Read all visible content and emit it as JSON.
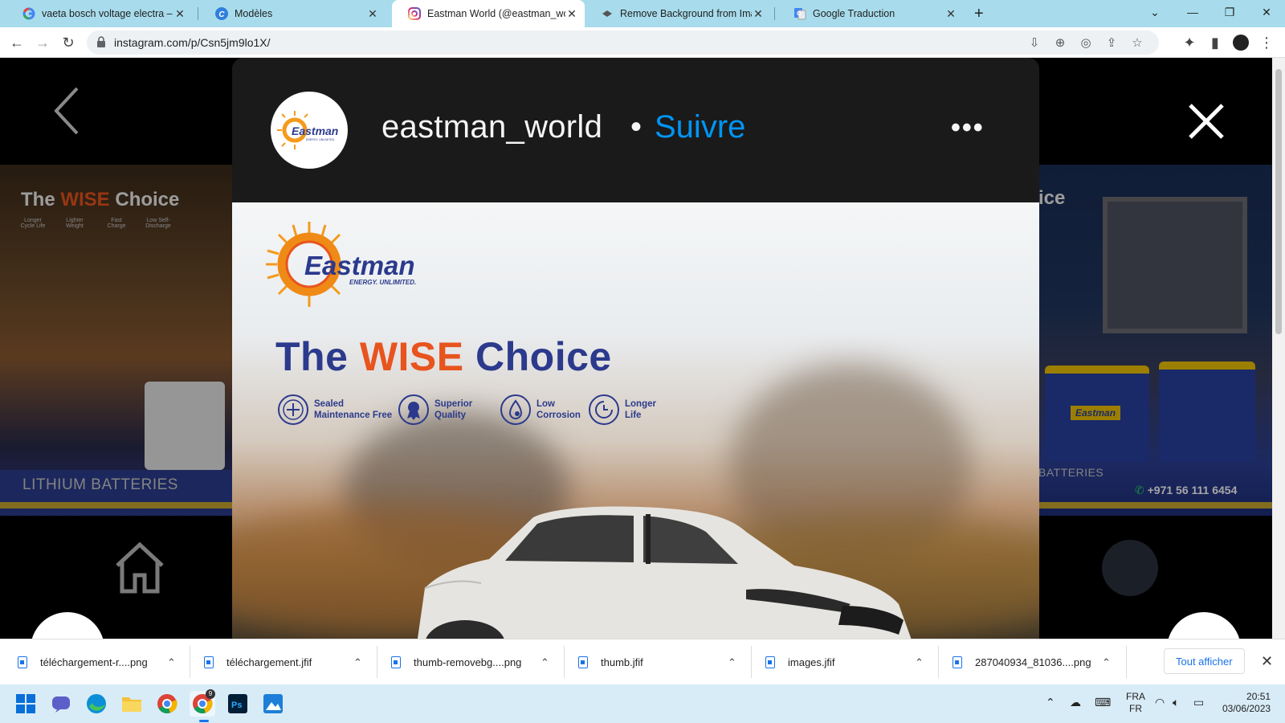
{
  "browser": {
    "tabs": [
      {
        "title": "vaeta bosch voltage electra – Rec",
        "favicon": "google-icon",
        "active": false
      },
      {
        "title": "Modèles",
        "favicon": "canva-icon",
        "active": false
      },
      {
        "title": "Eastman World (@eastman_world",
        "favicon": "instagram-icon",
        "active": true
      },
      {
        "title": "Remove Background from Image",
        "favicon": "removebg-icon",
        "active": false
      },
      {
        "title": "Google Traduction",
        "favicon": "google-translate-icon",
        "active": false
      }
    ],
    "new_tab": "+",
    "url": "instagram.com/p/Csn5jm9lo1X/"
  },
  "post": {
    "username": "eastman_world",
    "separator": "•",
    "follow_label": "Suivre",
    "more_label": "•••",
    "avatar_brand": "Eastman",
    "avatar_tagline": "ENERGY. UNLIMITED.",
    "image": {
      "brand": "Eastman",
      "tagline": "ENERGY. UNLIMITED.",
      "headline_1": "The",
      "headline_2": "WISE",
      "headline_3": "Choice",
      "features": [
        {
          "line1": "Sealed",
          "line2": "Maintenance Free"
        },
        {
          "line1": "Superior",
          "line2": "Quality"
        },
        {
          "line1": "Low",
          "line2": "Corrosion"
        },
        {
          "line1": "Longer",
          "line2": "Life"
        }
      ]
    }
  },
  "background_left": {
    "headline_1": "The",
    "headline_2": "WISE",
    "headline_3": "Choice",
    "features": [
      "Longer Cycle Life",
      "Lighter Weight",
      "Fast Charge",
      "Low Self-Discharge"
    ],
    "banner": "LITHIUM BATTERIES"
  },
  "background_right": {
    "headline": "ice",
    "banner": "BATTERIES",
    "phone": "+971 56 111 6454",
    "battery_brand": "Eastman"
  },
  "downloads": {
    "items": [
      "téléchargement-r....png",
      "téléchargement.jfif",
      "thumb-removebg....png",
      "thumb.jfif",
      "images.jfif",
      "287040934_81036....png"
    ],
    "show_all": "Tout afficher"
  },
  "taskbar": {
    "lang_top": "FRA",
    "lang_bottom": "FR",
    "time": "20:51",
    "date": "03/06/2023",
    "badge": "9"
  },
  "colors": {
    "follow_blue": "#0095f6",
    "brand_navy": "#2b3a8c",
    "brand_orange": "#e8541e"
  }
}
